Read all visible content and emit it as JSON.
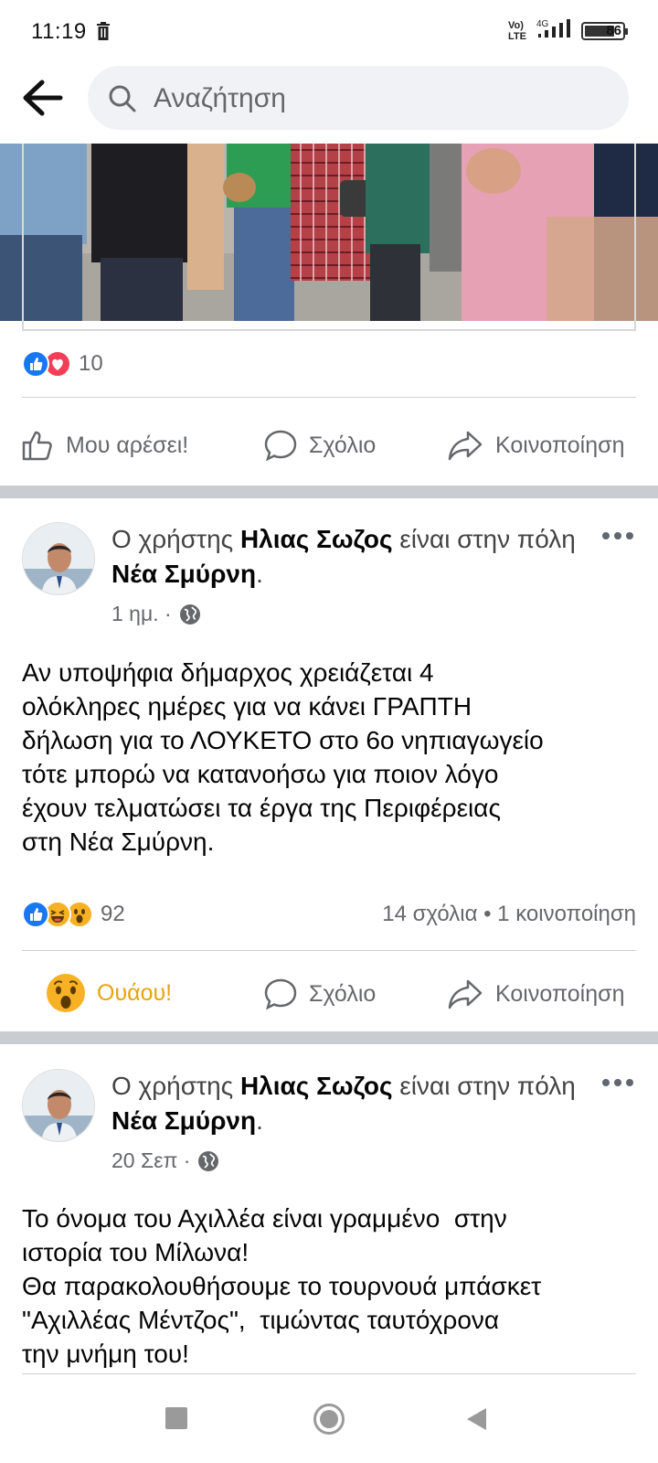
{
  "status": {
    "time": "11:19",
    "volte": "Vo)\nLTE",
    "network": "4G",
    "battery": "86"
  },
  "search": {
    "placeholder": "Αναζήτηση"
  },
  "post0": {
    "reaction_count": "10",
    "actions": {
      "like": "Μου αρέσει!",
      "comment": "Σχόλιο",
      "share": "Κοινοποίηση"
    }
  },
  "post1": {
    "prefix": "Ο χρήστης ",
    "author": "Ηλιας Σωζος",
    "middle": " είναι στην πόλη ",
    "place": "Νέα Σμύρνη",
    "suffix": ".",
    "time": "1 ημ. ·",
    "body": "Αν υποψήφια δήμαρχος χρειάζεται 4\nολόκληρες ημέρες για να κάνει ΓΡΑΠΤΗ\nδήλωση για το ΛΟΥΚΕΤΟ στο 6ο νηπιαγωγείο\nτότε μπορώ να κατανοήσω για ποιον λόγο\nέχουν τελματώσει τα έργα της Περιφέρειας\nστη Νέα Σμύρνη.",
    "reaction_count": "92",
    "stats": "14 σχόλια • 1 κοινοποίηση",
    "actions": {
      "reaction": "Ουάου!",
      "comment": "Σχόλιο",
      "share": "Κοινοποίηση"
    },
    "reaction_color": "#e7a40c"
  },
  "post2": {
    "prefix": "Ο χρήστης ",
    "author": "Ηλιας Σωζος",
    "middle": " είναι στην πόλη ",
    "place": "Νέα Σμύρνη",
    "suffix": ".",
    "time": "20 Σεπ ·",
    "body": "Το όνομα του Αχιλλέα είναι γραμμένο  στην\nιστορία του Μίλωνα!\nΘα παρακολουθήσουμε το τουρνουά μπάσκετ\n\"Αχιλλέας Μέντζος\",  τιμώντας ταυτόχρονα\nτην μνήμη του!"
  },
  "icons": [
    "trash-icon",
    "back-arrow-icon",
    "search-icon",
    "like-icon",
    "comment-icon",
    "share-icon",
    "globe-icon",
    "more-icon",
    "wow-icon",
    "nav-recents-icon",
    "nav-home-icon",
    "nav-back-icon"
  ]
}
